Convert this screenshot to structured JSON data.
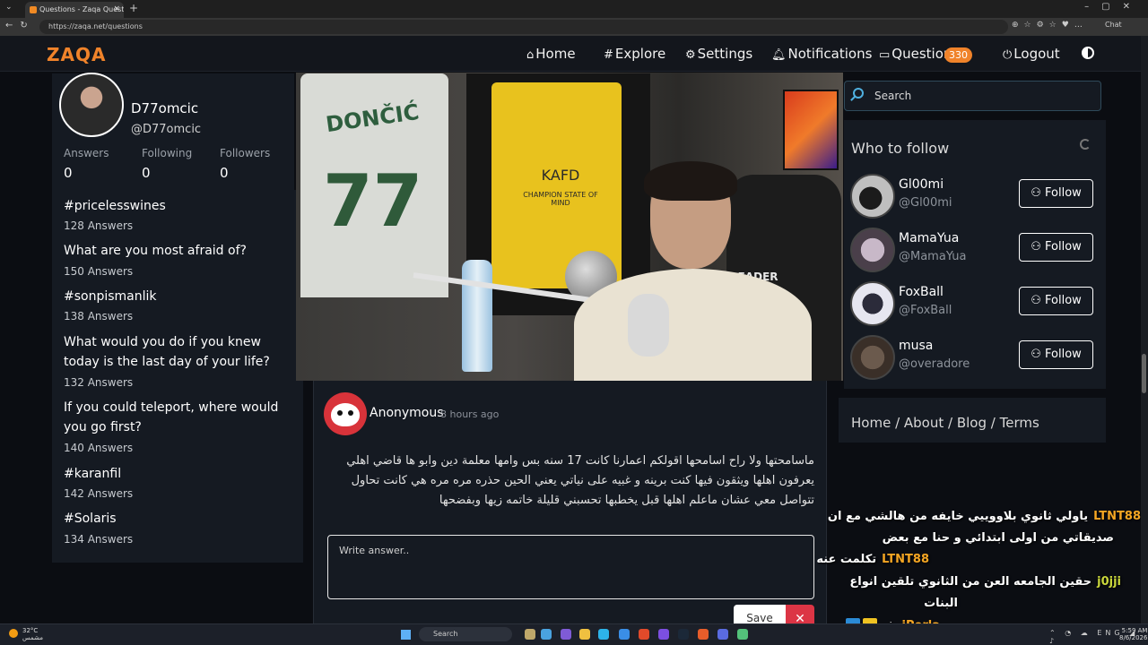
{
  "browser": {
    "tab_title": "Questions - Zaqa Question & Ans",
    "url": "https://zaqa.net/questions",
    "chat_label": "Chat"
  },
  "site": {
    "logo": "ZAQA",
    "accent_color": "#f0832a",
    "nav": {
      "home": "Home",
      "explore": "Explore",
      "settings": "Settings",
      "notifications": "Notifications",
      "questions": "Questions",
      "questions_badge": "330",
      "logout": "Logout"
    }
  },
  "profile": {
    "display_name": "D77omcic",
    "username": "@D77omcic",
    "stats": [
      {
        "label": "Answers",
        "value": "0"
      },
      {
        "label": "Following",
        "value": "0"
      },
      {
        "label": "Followers",
        "value": "0"
      }
    ]
  },
  "trending": [
    {
      "title": "#pricelesswines",
      "count": "128 Answers"
    },
    {
      "title": "What are you most afraid of?",
      "count": "150 Answers"
    },
    {
      "title": "#sonpismanlik",
      "count": "138 Answers"
    },
    {
      "title": "What would you do if you knew today is the last day of your life?",
      "count": "132 Answers"
    },
    {
      "title": "If you could teleport, where would you go first?",
      "count": "140 Answers"
    },
    {
      "title": "#karanfil",
      "count": "142 Answers"
    },
    {
      "title": "#Solaris",
      "count": "134 Answers"
    }
  ],
  "video": {
    "jersey_name": "DONČIĆ",
    "jersey_number": "77",
    "yellow_jersey_text": "KAFD",
    "yellow_jersey_sub": "CHAMPION STATE OF MIND",
    "chair_text": "LEADER"
  },
  "question": {
    "asker": "Anonymous",
    "time": "8 hours ago",
    "text": "ماسامحتها ولا راح اسامحها اقولكم اعمارنا كانت 17 سنه بس وامها معلمة دين وابو ها قاضي اهلي يعرفون اهلها ويثقون فيها كنت برينه و غبيه على نياتي يعني الحين حذره مره مره هي كانت تحاول تتواصل معي عشان ماعلم اهلها قبل يخطبها تحسبني قليلة خاتمه زيها وبفضحها",
    "answer_placeholder": "Write answer..",
    "save_label": "Save",
    "cancel_label": "✕"
  },
  "sidebar": {
    "search_placeholder": "Search",
    "who_to_follow_title": "Who to follow",
    "follow_label": "Follow",
    "suggestions": [
      {
        "name": "Gl00mi",
        "handle": "@Gl00mi"
      },
      {
        "name": "MamaYua",
        "handle": "@MamaYua"
      },
      {
        "name": "FoxBall",
        "handle": "@FoxBall"
      },
      {
        "name": "musa",
        "handle": "@overadore"
      }
    ],
    "footer": {
      "home": "Home",
      "about": "About",
      "blog": "Blog",
      "terms": "Terms",
      "sep": " / "
    }
  },
  "chat": [
    {
      "user": "LTNT88",
      "message": "ياولي ثانوي بلاووييي خايفه من هالشي مع ان"
    },
    {
      "user": "",
      "message": "صديقاتي من اولى ابتدائي و حنا مع بعض"
    },
    {
      "user": "LTNT88",
      "message": "تكلمت عنه"
    },
    {
      "user": "j0jji",
      "message": "حقين الجامعه العن من الثانوي تلقين انواع"
    },
    {
      "user": "",
      "message": "البنات"
    },
    {
      "user": "iPerla",
      "message": "شو"
    }
  ],
  "taskbar": {
    "temp": "32°C",
    "weather": "مشمس",
    "search": "Search",
    "lang": "ENG",
    "time": "5:59 AM",
    "date": "8/6/2026"
  }
}
